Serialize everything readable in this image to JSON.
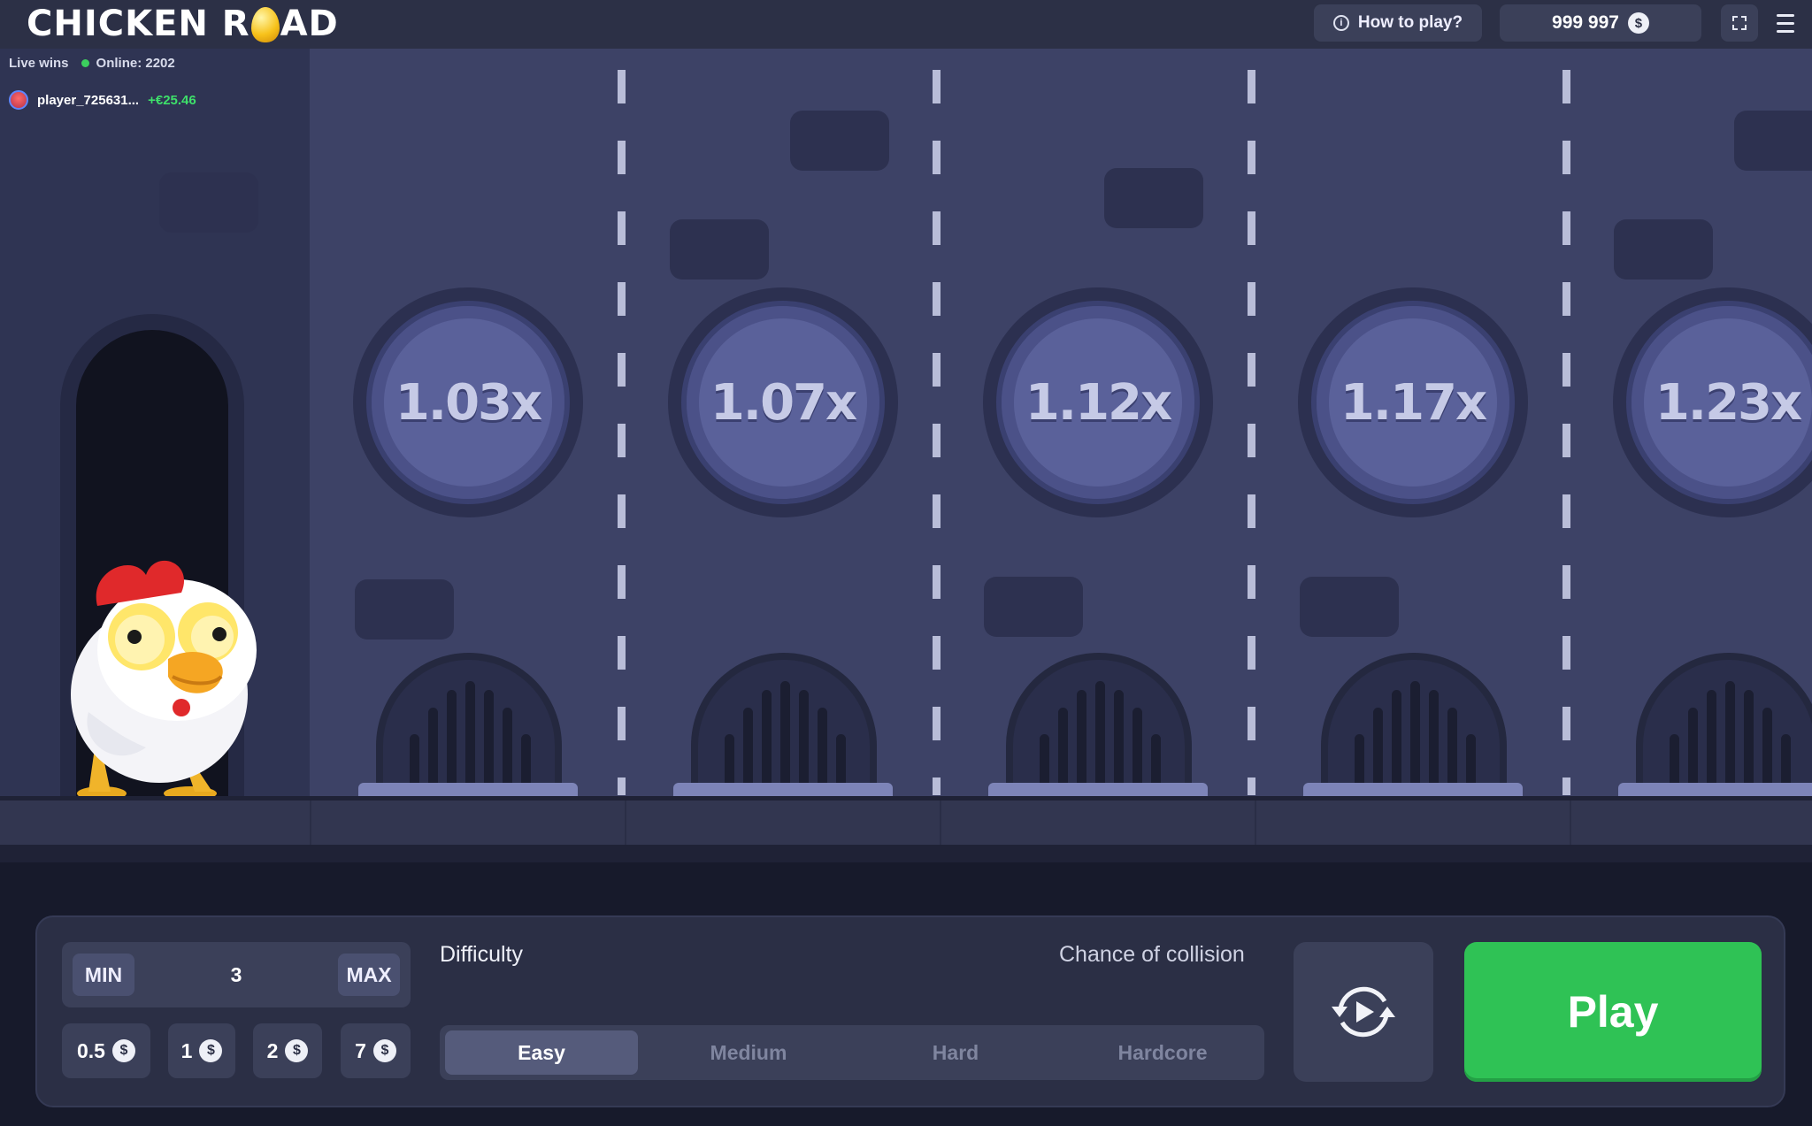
{
  "header": {
    "logo_left": "CHICKEN R",
    "logo_right": "AD",
    "how_to_play": "How to play?",
    "balance": "999 997",
    "currency_icon": "dollar-coin-icon"
  },
  "live": {
    "title": "Live wins",
    "online": "Online: 2202",
    "wins": [
      {
        "player": "player_725631...",
        "amount": "+€25.46"
      }
    ]
  },
  "lanes": [
    {
      "multiplier": "1.03x"
    },
    {
      "multiplier": "1.07x"
    },
    {
      "multiplier": "1.12x"
    },
    {
      "multiplier": "1.17x"
    },
    {
      "multiplier": "1.23x"
    }
  ],
  "controls": {
    "min_label": "MIN",
    "max_label": "MAX",
    "bet_value": "3",
    "quick_bets": [
      "0.5",
      "1",
      "2",
      "7"
    ],
    "difficulty_label": "Difficulty",
    "chance_label": "Chance of collision",
    "difficulties": [
      "Easy",
      "Medium",
      "Hard",
      "Hardcore"
    ],
    "selected_difficulty": "Easy",
    "play_label": "Play"
  },
  "colors": {
    "play": "#2fc255",
    "win": "#3ee06a",
    "road": "#3d4266"
  }
}
